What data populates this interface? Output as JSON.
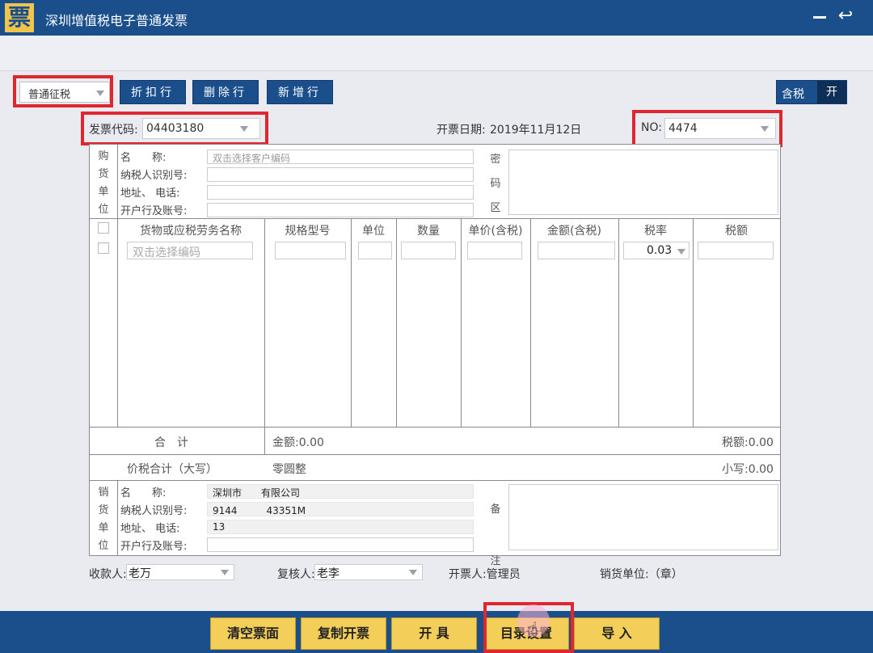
{
  "window": {
    "title": "深圳增值税电子普通发票",
    "logo_char": "票"
  },
  "toolbar": {
    "tax_type": "普通征税",
    "buttons": [
      "折扣行",
      "删除行",
      "新增行"
    ],
    "tax_toggle_label": "含税",
    "tax_toggle_state": "开"
  },
  "header": {
    "code_label": "发票代码:",
    "code_value": "04403180",
    "date_label": "开票日期:",
    "date_value": "2019年11月12日",
    "no_label": "NO:",
    "no_value": "4474"
  },
  "buyer": {
    "side_label": [
      "购",
      "货",
      "单",
      "位"
    ],
    "name_label": "名　　称:",
    "name_placeholder": "双击选择客户编码",
    "tax_id_label": "纳税人识别号:",
    "addr_label": "地址、 电话:",
    "bank_label": "开户行及账号:",
    "secret_label": [
      "密",
      "码",
      "区"
    ]
  },
  "items": {
    "columns": [
      "货物或应税劳务名称",
      "规格型号",
      "单位",
      "数量",
      "单价(含税)",
      "金额(含税)",
      "税率",
      "税额"
    ],
    "name_placeholder": "双击选择编码",
    "rate_value": "0.03"
  },
  "totals": {
    "sum_label": "合　计",
    "amount": "金额:0.00",
    "tax": "税额:0.00",
    "total_caps_label": "价税合计（大写）",
    "total_caps": "零圆整",
    "total_small": "小写:0.00"
  },
  "seller": {
    "side_label": [
      "销",
      "货",
      "单",
      "位"
    ],
    "name_label": "名　　称:",
    "name_value": "深圳市　　有限公司",
    "tax_id_label": "纳税人识别号:",
    "tax_id_value": "9144　　　43351M",
    "addr_label": "地址、 电话:",
    "addr_value": "13",
    "bank_label": "开户行及账号:",
    "remark_label": [
      "备",
      "注"
    ]
  },
  "people": {
    "payee_label": "收款人:",
    "payee_value": "老万",
    "reviewer_label": "复核人:",
    "reviewer_value": "老李",
    "issuer": "开票人:管理员",
    "seal": "销货单位:（章）"
  },
  "footer": {
    "buttons": [
      "清空票面",
      "复制开票",
      "开 具",
      "目录设置",
      "导 入"
    ]
  },
  "colors": {
    "primary": "#1a4f8b",
    "accent_button": "#f3cf59",
    "highlight": "#e0262f"
  }
}
